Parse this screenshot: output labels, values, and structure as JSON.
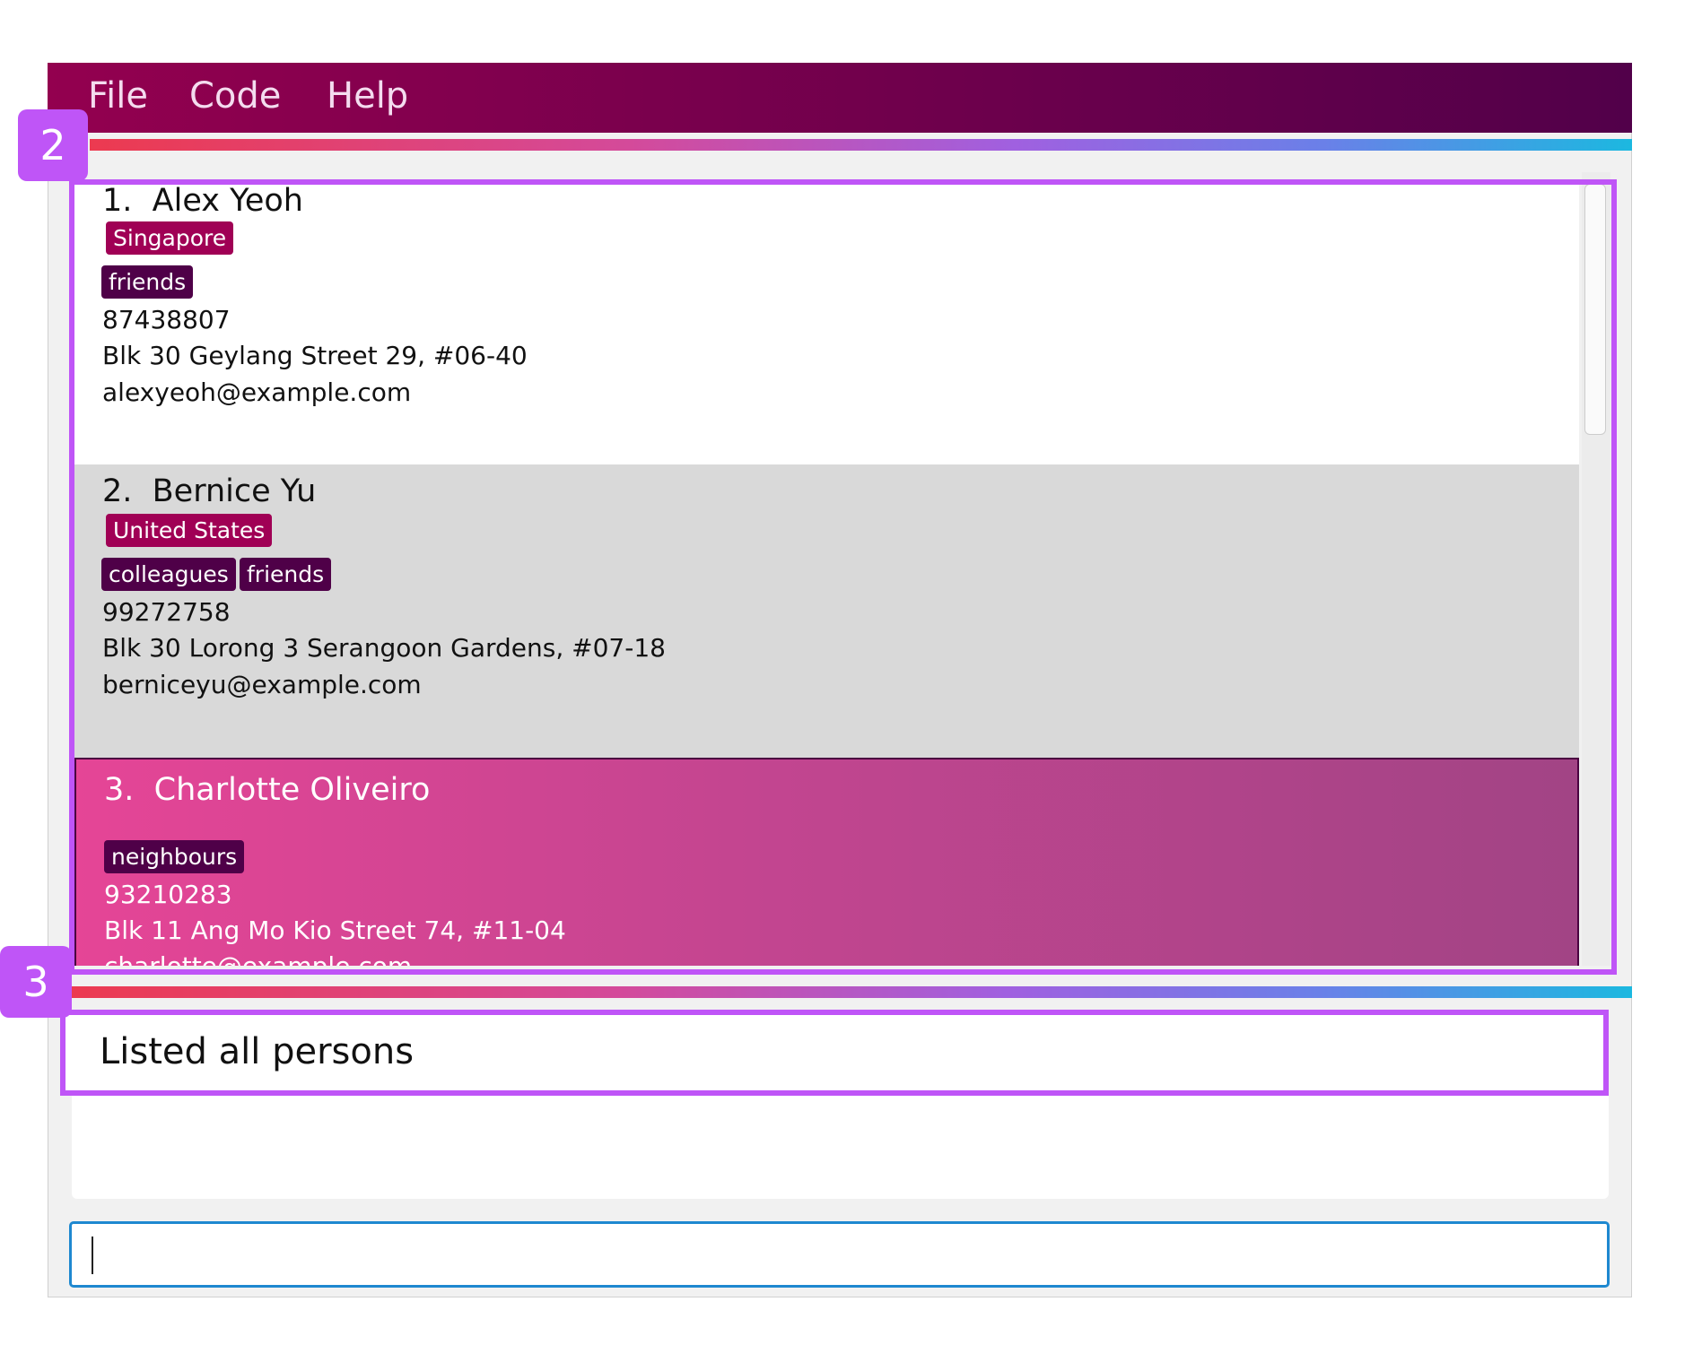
{
  "menu": {
    "items": [
      "File",
      "Code",
      "Help"
    ]
  },
  "annotations": {
    "list_badge": "2",
    "result_badge": "3"
  },
  "persons": [
    {
      "index": "1.",
      "name": "Alex Yeoh",
      "country": "Singapore",
      "tags": [
        "friends"
      ],
      "phone": "87438807",
      "address": "Blk 30 Geylang Street 29, #06-40",
      "email": "alexyeoh@example.com"
    },
    {
      "index": "2.",
      "name": "Bernice Yu",
      "country": "United States",
      "tags": [
        "colleagues",
        "friends"
      ],
      "phone": "99272758",
      "address": "Blk 30 Lorong 3 Serangoon Gardens, #07-18",
      "email": "berniceyu@example.com"
    },
    {
      "index": "3.",
      "name": "Charlotte Oliveiro",
      "tags": [
        "neighbours"
      ],
      "phone": "93210283",
      "address": "Blk 11 Ang Mo Kio Street 74, #11-04",
      "email": "charlotte@example.com"
    }
  ],
  "result": {
    "message": "Listed all persons"
  },
  "command": {
    "value": ""
  },
  "colors": {
    "annotation": "#bf55f7",
    "menubar": "#93004f",
    "country_tag": "#a00055",
    "tag": "#4f0048",
    "selected_card": "#e54596",
    "command_border": "#1e88d0"
  }
}
